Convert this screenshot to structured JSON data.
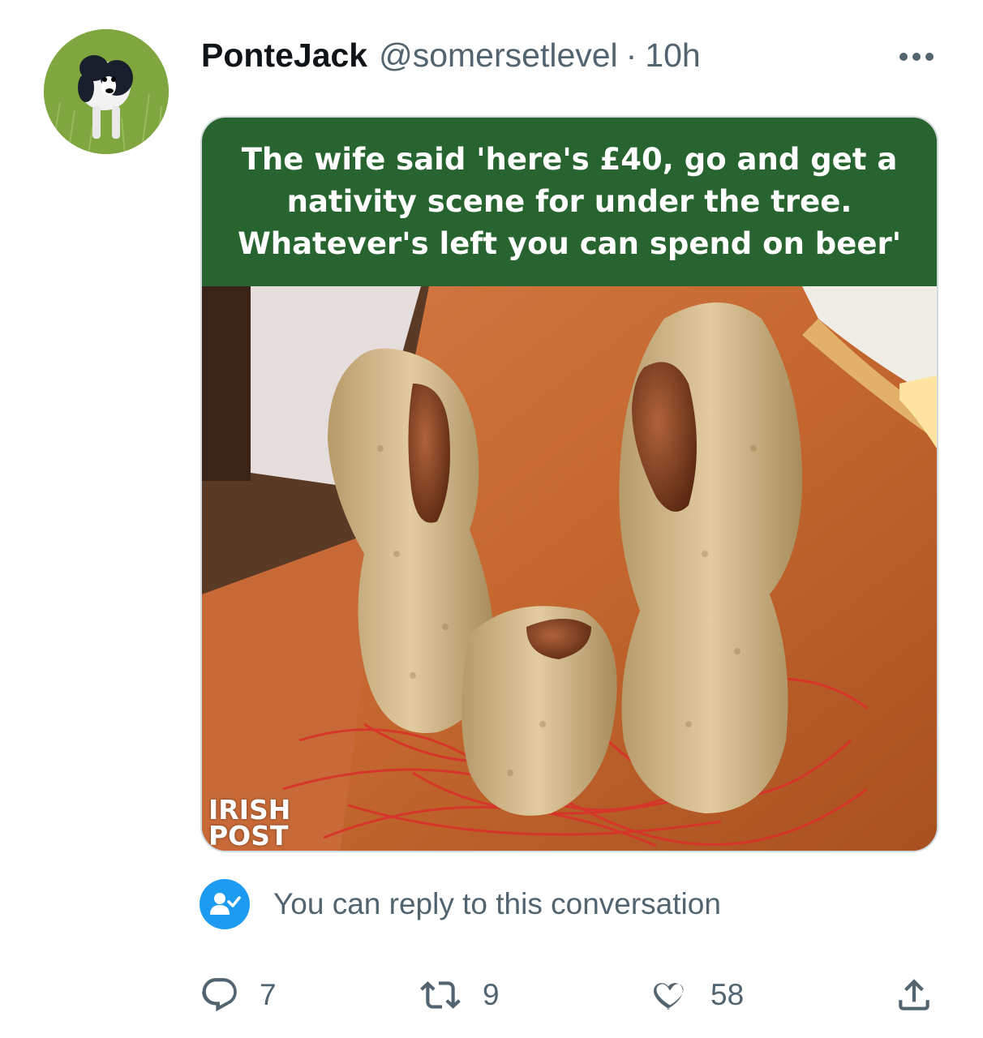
{
  "tweet": {
    "display_name": "PonteJack",
    "handle": "@somersetlevel",
    "separator": "·",
    "time": "10h"
  },
  "media": {
    "caption": "The wife said 'here's £40, go and get a nativity scene for under the tree. Whatever's left you can spend on beer'",
    "watermark_line1": "IRISH",
    "watermark_line2": "POST"
  },
  "reply_notice": {
    "text": "You can reply to this conversation"
  },
  "actions": {
    "replies": "7",
    "retweets": "9",
    "likes": "58"
  },
  "icons": {
    "more": "more-icon",
    "reply": "reply-icon",
    "retweet": "retweet-icon",
    "like": "heart-icon",
    "share": "share-icon",
    "reply_badge": "person-check-icon"
  },
  "colors": {
    "accent": "#1d9bf0",
    "secondary_text": "#536471",
    "banner_green": "#27642f"
  }
}
